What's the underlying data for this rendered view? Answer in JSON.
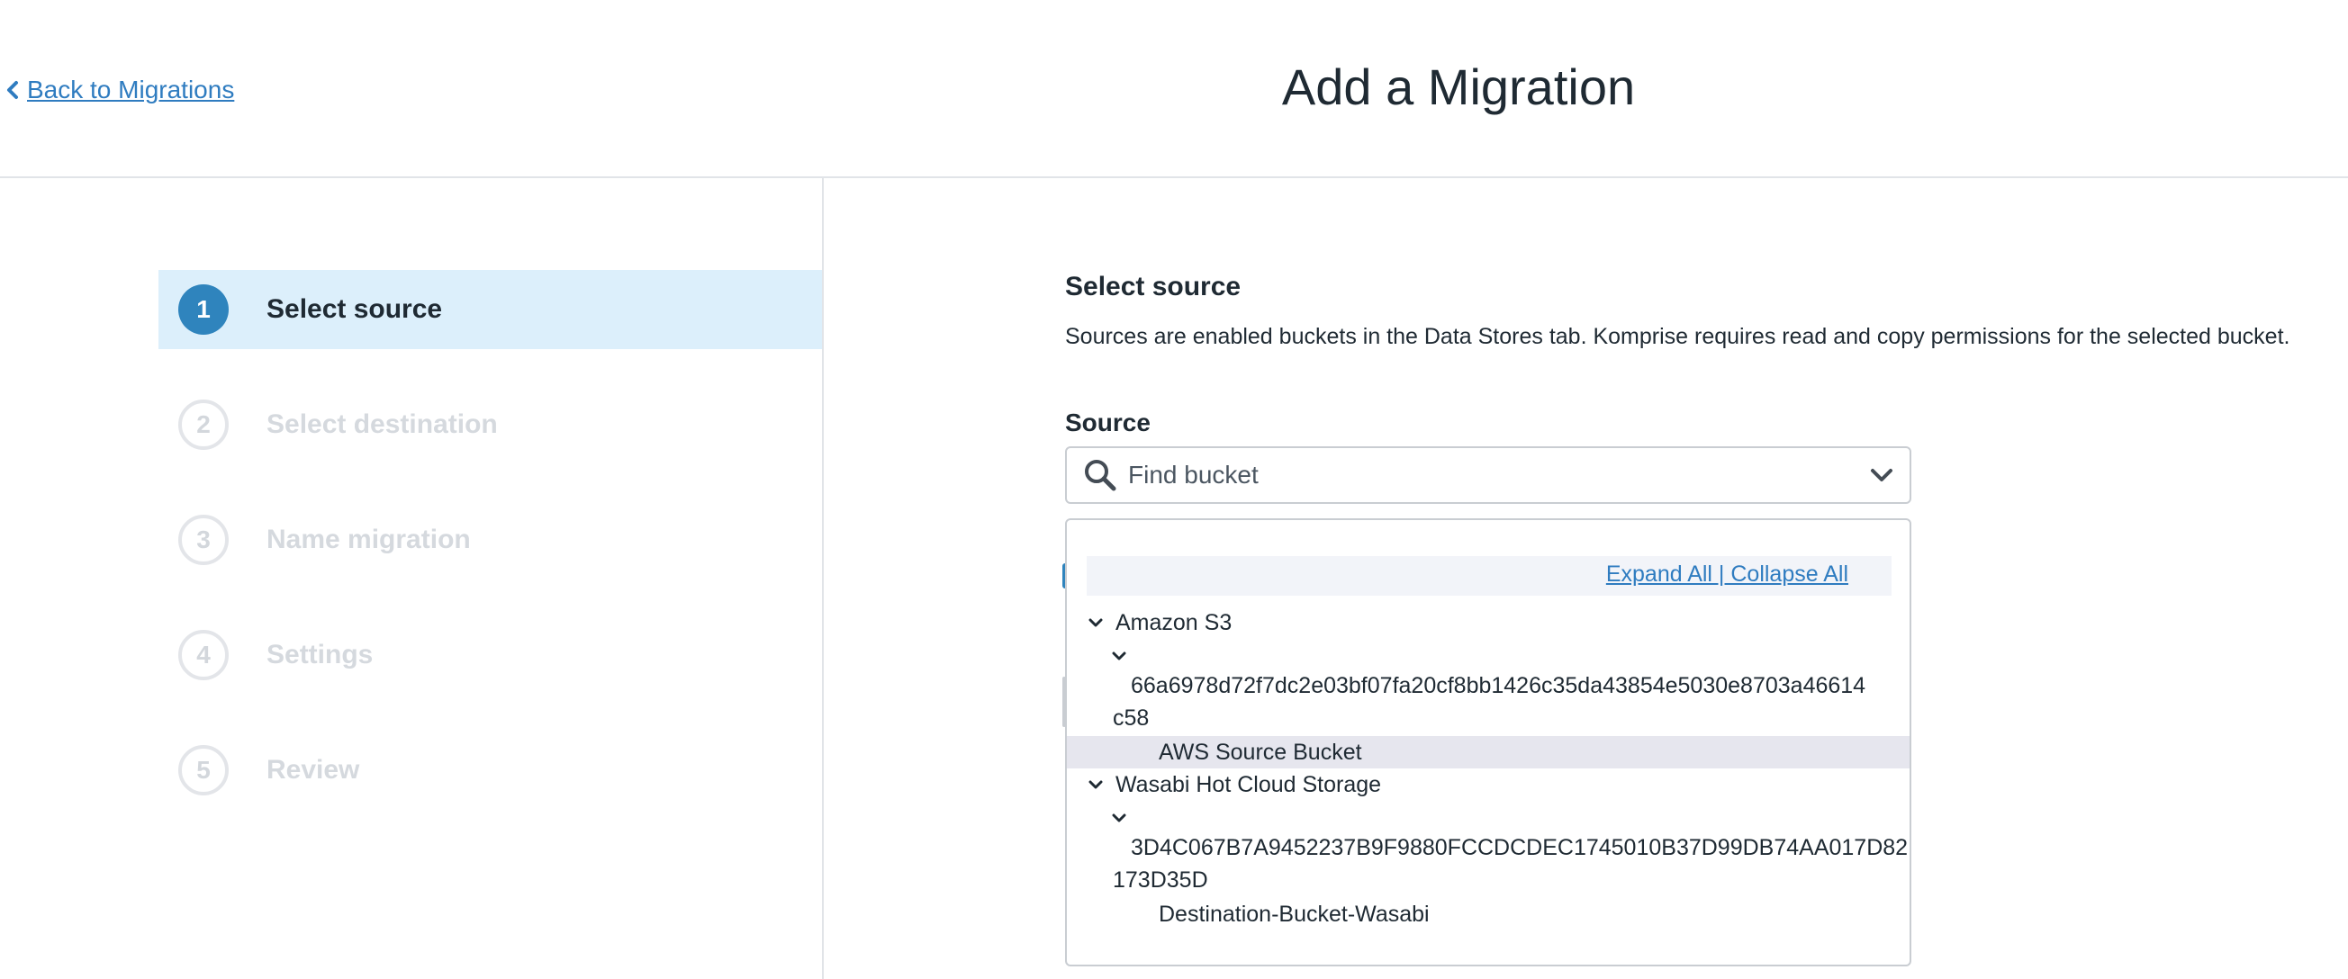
{
  "header": {
    "back_label": "Back to Migrations",
    "title": "Add a Migration"
  },
  "steps": [
    {
      "num": "1",
      "label": "Select source",
      "state": "active"
    },
    {
      "num": "2",
      "label": "Select destination",
      "state": "inactive"
    },
    {
      "num": "3",
      "label": "Name migration",
      "state": "inactive"
    },
    {
      "num": "4",
      "label": "Settings",
      "state": "inactive"
    },
    {
      "num": "5",
      "label": "Review",
      "state": "inactive"
    }
  ],
  "main": {
    "section_title": "Select source",
    "description": "Sources are enabled buckets in the Data Stores tab. Komprise requires read and copy permissions for the selected bucket.",
    "source_label": "Source",
    "search_placeholder": "Find bucket"
  },
  "dropdown": {
    "expand_collapse": "Expand All | Collapse All",
    "groups": [
      {
        "provider": "Amazon S3",
        "account_line1": "66a6978d72f7dc2e03bf07fa20cf8bb1426c35da43854e5030e8703a46614",
        "account_line2": "c58",
        "bucket": "AWS Source Bucket"
      },
      {
        "provider": "Wasabi Hot Cloud Storage",
        "account_line1": "3D4C067B7A9452237B9F9880FCCDCDEC1745010B37D99DB74AA017D82",
        "account_line2": "173D35D",
        "bucket": "Destination-Bucket-Wasabi"
      }
    ]
  },
  "colors": {
    "accent": "#2f84bd",
    "link": "#2f7cc0",
    "active_step_bg": "#dceffb",
    "selected_row_bg": "#e6e6ee"
  },
  "icons": {
    "back": "chevron-left-icon",
    "search": "search-icon",
    "dropdown": "chevron-down-icon",
    "tree_toggle": "chevron-down-icon"
  }
}
